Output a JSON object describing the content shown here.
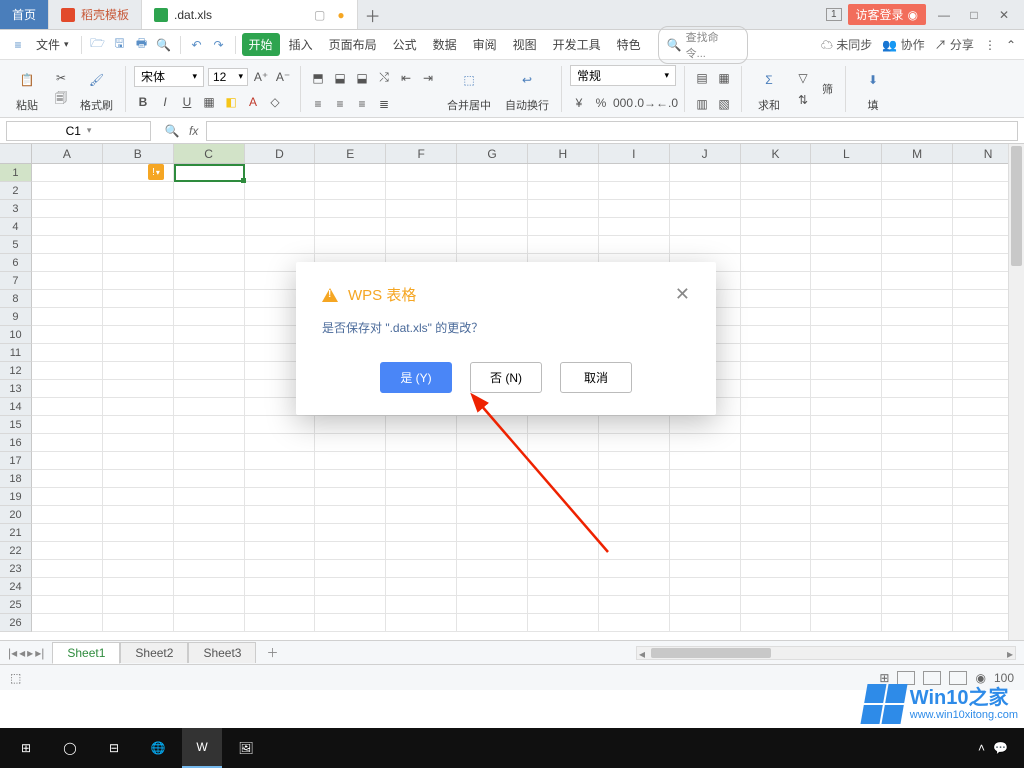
{
  "titlebar": {
    "home": "首页",
    "template": "稻壳模板",
    "doc": ".dat.xls",
    "badge": "1",
    "login": "访客登录"
  },
  "menubar": {
    "file": "文件",
    "tabs": [
      "开始",
      "插入",
      "页面布局",
      "公式",
      "数据",
      "审阅",
      "视图",
      "开发工具",
      "特色"
    ],
    "search_placeholder": "查找命令...",
    "sync": "未同步",
    "coop": "协作",
    "share": "分享"
  },
  "toolbar": {
    "paste": "粘贴",
    "format_painter": "格式刷",
    "font_name": "宋体",
    "font_size": "12",
    "merge": "合并居中",
    "wrap": "自动换行",
    "number_format": "常规",
    "sum": "求和",
    "filter": "筛",
    "fill": "填"
  },
  "namebox": {
    "cell": "C1",
    "fx": "fx"
  },
  "columns": [
    "A",
    "B",
    "C",
    "D",
    "E",
    "F",
    "G",
    "H",
    "I",
    "J",
    "K",
    "L",
    "M",
    "N"
  ],
  "rows": 26,
  "sheets": {
    "active": "Sheet1",
    "others": [
      "Sheet2",
      "Sheet3"
    ]
  },
  "status": {
    "zoom": "100"
  },
  "dialog": {
    "title": "WPS 表格",
    "message": "是否保存对 \".dat.xls\" 的更改？",
    "yes": "是 (Y)",
    "no": "否 (N)",
    "cancel": "取消"
  },
  "watermark": {
    "big": "Win10之家",
    "small": "www.win10xitong.com"
  }
}
